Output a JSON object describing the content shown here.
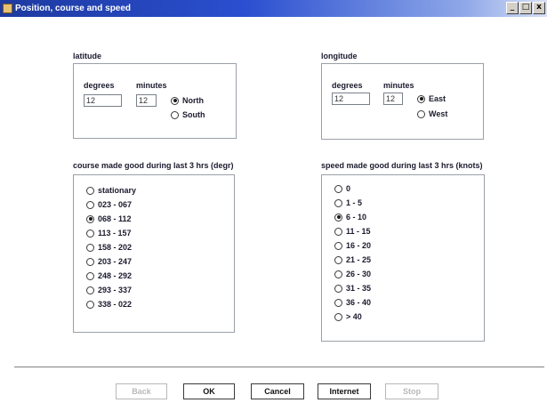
{
  "window": {
    "title": "Position, course and speed",
    "buttons": [
      "_",
      "□",
      "x"
    ]
  },
  "latitude": {
    "label": "latitude",
    "degrees_label": "degrees",
    "minutes_label": "minutes",
    "degrees_value": "12",
    "minutes_value": "12",
    "options": [
      {
        "label": "North",
        "checked": true
      },
      {
        "label": "South",
        "checked": false
      }
    ]
  },
  "longitude": {
    "label": "longitude",
    "degrees_label": "degrees",
    "minutes_label": "minutes",
    "degrees_value": "12",
    "minutes_value": "12",
    "options": [
      {
        "label": "East",
        "checked": true
      },
      {
        "label": "West",
        "checked": false
      }
    ]
  },
  "course": {
    "label": "course made good during last 3 hrs (degr)",
    "options": [
      {
        "label": "stationary",
        "checked": false
      },
      {
        "label": "023 - 067",
        "checked": false
      },
      {
        "label": "068 - 112",
        "checked": true
      },
      {
        "label": "113 - 157",
        "checked": false
      },
      {
        "label": "158 - 202",
        "checked": false
      },
      {
        "label": "203 - 247",
        "checked": false
      },
      {
        "label": "248 - 292",
        "checked": false
      },
      {
        "label": "293 - 337",
        "checked": false
      },
      {
        "label": "338 - 022",
        "checked": false
      }
    ]
  },
  "speed": {
    "label": "speed made good during last 3 hrs (knots)",
    "options": [
      {
        "label": "0",
        "checked": false
      },
      {
        "label": "1 - 5",
        "checked": false
      },
      {
        "label": "6 - 10",
        "checked": true
      },
      {
        "label": "11 - 15",
        "checked": false
      },
      {
        "label": "16 - 20",
        "checked": false
      },
      {
        "label": "21 - 25",
        "checked": false
      },
      {
        "label": "26 - 30",
        "checked": false
      },
      {
        "label": "31 - 35",
        "checked": false
      },
      {
        "label": "36 - 40",
        "checked": false
      },
      {
        "label": "> 40",
        "checked": false
      }
    ]
  },
  "footer": {
    "back_label": "Back",
    "ok_label": "OK",
    "cancel_label": "Cancel",
    "internet_label": "Internet",
    "stop_label": "Stop"
  }
}
